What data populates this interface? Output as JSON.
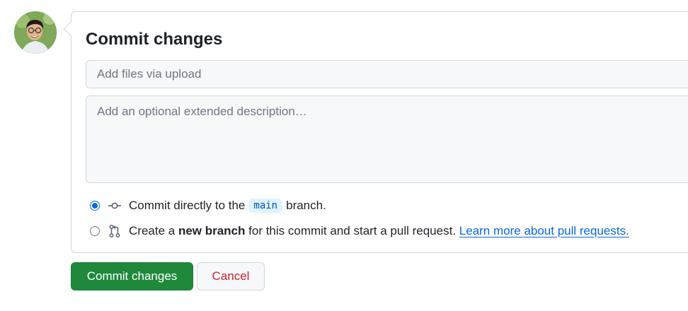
{
  "user": {
    "avatar_icon": "user-avatar"
  },
  "form": {
    "title": "Commit changes",
    "summary_placeholder": "Add files via upload",
    "description_placeholder": "Add an optional extended description…"
  },
  "options": {
    "direct": {
      "selected": true,
      "icon": "git-commit-icon",
      "text_before": "Commit directly to the",
      "branch": "main",
      "text_after": "branch."
    },
    "new_branch": {
      "selected": false,
      "icon": "git-pull-request-icon",
      "text_before": "Create a",
      "bold_text": "new branch",
      "text_after": "for this commit and start a pull request.",
      "link_text": "Learn more about pull requests."
    }
  },
  "buttons": {
    "commit_label": "Commit changes",
    "cancel_label": "Cancel"
  },
  "colors": {
    "primary": "#1f883d",
    "cancel_text": "#cf222e",
    "link": "#0969da",
    "branch_bg": "#ddf4ff"
  }
}
